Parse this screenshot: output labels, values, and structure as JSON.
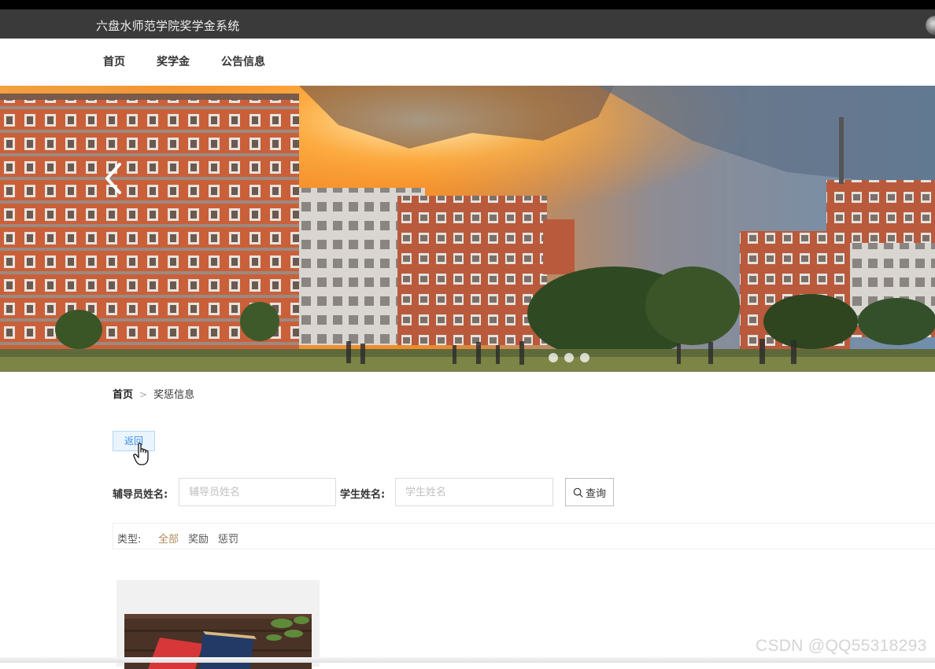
{
  "header": {
    "site_title": "六盘水师范学院奖学金系统"
  },
  "nav": {
    "items": [
      "首页",
      "奖学金",
      "公告信息"
    ]
  },
  "breadcrumb": {
    "home": "首页",
    "separator": ">",
    "current": "奖惩信息"
  },
  "actions": {
    "back_label": "返回"
  },
  "search": {
    "counselor_label": "辅导员姓名:",
    "counselor_placeholder": "辅导员姓名",
    "student_label": "学生姓名:",
    "student_placeholder": "学生姓名",
    "query_label": "查询"
  },
  "filter": {
    "label": "类型:",
    "options": [
      "全部",
      "奖励",
      "惩罚"
    ],
    "selected": "全部"
  },
  "carousel": {
    "slide_count": 3
  },
  "watermark": "CSDN @QQ55318293",
  "colors": {
    "topbar": "#3a3a3a",
    "active_filter": "#b08a5a",
    "back_button": "#3a8ee6"
  }
}
